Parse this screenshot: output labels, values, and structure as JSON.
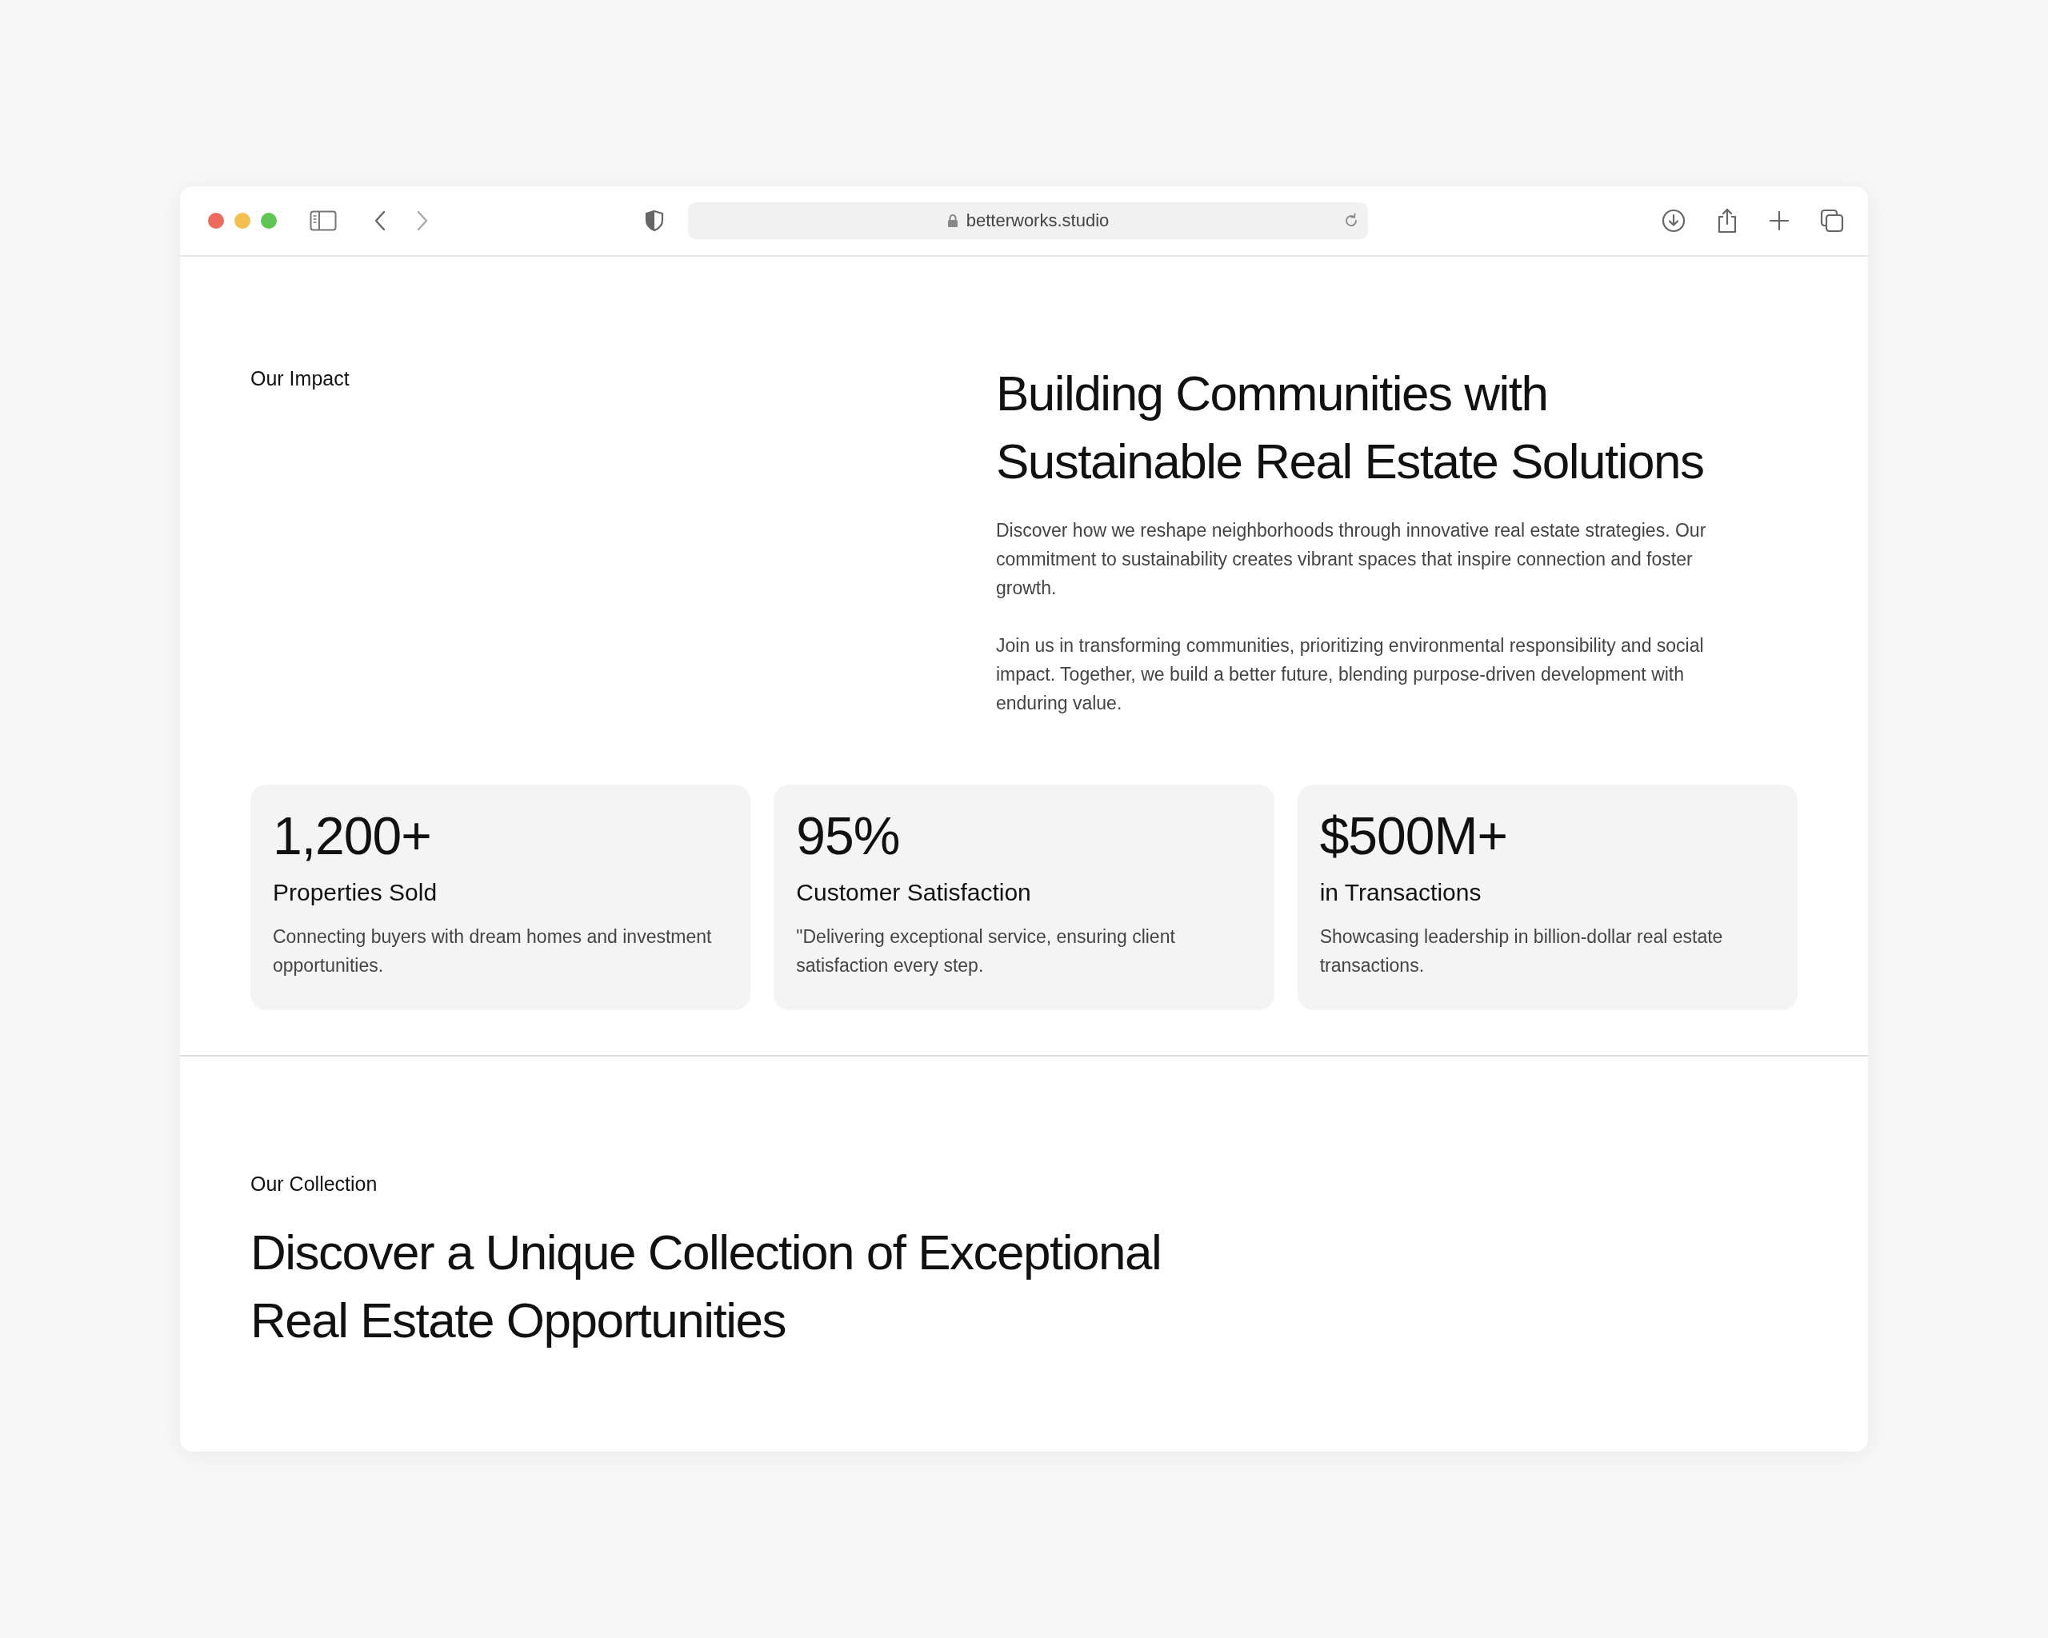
{
  "browser": {
    "url": "betterworks.studio"
  },
  "impact": {
    "eyebrow": "Our Impact",
    "heading": "Building Communities with Sustainable Real Estate Solutions",
    "paragraphs": [
      "Discover how we reshape neighborhoods through innovative real estate strategies. Our commitment to sustainability creates vibrant spaces that inspire connection and foster growth.",
      "Join us in transforming communities, prioritizing environmental responsibility and social impact. Together, we build a better future, blending purpose-driven development with enduring value."
    ]
  },
  "stats": [
    {
      "value": "1,200+",
      "label": "Properties Sold",
      "description": "Connecting buyers with dream homes and investment opportunities."
    },
    {
      "value": "95%",
      "label": "Customer Satisfaction",
      "description": "\"Delivering exceptional service, ensuring client satisfaction every step."
    },
    {
      "value": "$500M+",
      "label": "in Transactions",
      "description": "Showcasing leadership in billion-dollar real estate transactions."
    }
  ],
  "collection": {
    "eyebrow": "Our Collection",
    "heading": "Discover a Unique Collection of Exceptional Real Estate Opportunities"
  }
}
